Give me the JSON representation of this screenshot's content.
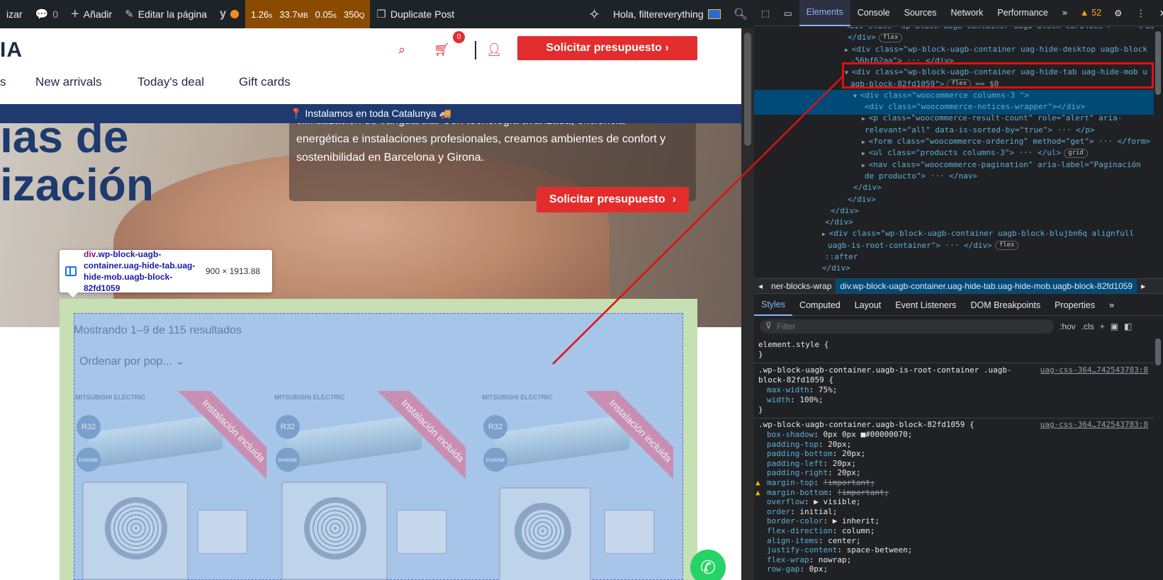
{
  "admin_bar": {
    "customize": "izar",
    "comments_count": "0",
    "add_new": "Añadir",
    "edit_page": "Editar la página",
    "yoast": "y",
    "qm_time": "1.26",
    "qm_time_unit": "s",
    "qm_memory": "33.7",
    "qm_memory_unit": "MB",
    "qm_db_time": "0.05",
    "qm_db_time_unit": "s",
    "qm_queries": "350",
    "qm_queries_unit": "Q",
    "duplicate_post": "Duplicate Post",
    "greeting": "Hola, filtereverything"
  },
  "site": {
    "logo": "IA",
    "cart_count": "0",
    "cta_top": "Solicitar presupuesto ›",
    "nav": [
      "s",
      "New arrivals",
      "Today's deal",
      "Gift cards"
    ],
    "announcement": "📍 Instalamos en toda Catalunya 🚚",
    "hero_line1": "ıas de",
    "hero_line2": "ización",
    "hero_text_1": "climatización de vanguardia. Con tecnología avanzada, eficiencia",
    "hero_text_2": "energética e instalaciones profesionales, creamos ambientes de confort y",
    "hero_text_3": "sostenibilidad en Barcelona y Girona.",
    "hero_cta": "Solicitar presupuesto",
    "hero_cta_arrow": "›",
    "result_count": "Mostrando 1–9 de 115 resultados",
    "ordering": "Ordenar por pop...",
    "products": [
      {
        "brand": "MITSUBISHI ELECTRIC",
        "ribbon": "Instalación incluida",
        "badge1": "R32",
        "badge2": "Inverter"
      },
      {
        "brand": "MITSUBISHI ELECTRIC",
        "ribbon": "Instalación incluida",
        "badge1": "R32",
        "badge2": "Inverter"
      },
      {
        "brand": "MITSUBISHI ELECTRIC",
        "ribbon": "Instalación incluida",
        "badge1": "R32",
        "badge2": "Inverter"
      }
    ]
  },
  "tooltip": {
    "tag": "div",
    "classes": ".wp-block-uagb-container.uag-hide-tab.uag-hide-mob.uagb-block-82fd1059",
    "dims": "900 × 1913.88"
  },
  "devtools": {
    "tabs": [
      "Elements",
      "Console",
      "Sources",
      "Network",
      "Performance"
    ],
    "more": "»",
    "warnings": "52",
    "dom_lines": [
      {
        "t": "<div class=\"wp-block-uagb-container uagb-block-card4dce\"> ··· </div>",
        "indent": 140
      },
      {
        "t": "</div>",
        "indent": 144,
        "pill": "flex"
      },
      {
        "t": "<div class=\"wp-block-uagb-container uag-hide-desktop uagb-block",
        "indent": 140,
        "tri": "▶"
      },
      {
        "t": "-56bf62aa\"> ··· </div>",
        "indent": 148
      },
      {
        "t": "<div class=\"wp-block-uagb-container uag-hide-tab uag-hide-mob u",
        "indent": 140,
        "tri": "▼"
      },
      {
        "t": "agb-block-82fd1059\">",
        "indent": 148,
        "pill": "flex",
        "after": "== $0"
      },
      {
        "t": "<div class=\"woocommerce columns-3 \">",
        "indent": 152,
        "tri": "▼"
      },
      {
        "t": "<div class=\"woocommerce-notices-wrapper\"></div>",
        "indent": 168
      },
      {
        "t": "<p class=\"woocommerce-result-count\" role=\"alert\" aria-",
        "indent": 164,
        "tri": "▶"
      },
      {
        "t": "relevant=\"all\" data-is-sorted-by=\"true\"> ··· </p>",
        "indent": 168
      },
      {
        "t": "<form class=\"woocommerce-ordering\" method=\"get\"> ··· </form>",
        "indent": 164,
        "tri": "▶"
      },
      {
        "t": "<ul class=\"products columns-3\"> ··· </ul>",
        "indent": 164,
        "tri": "▶",
        "pill": "grid"
      },
      {
        "t": "<nav class=\"woocommerce-pagination\" aria-label=\"Paginación",
        "indent": 164,
        "tri": "▶"
      },
      {
        "t": "de producto\"> ··· </nav>",
        "indent": 168
      },
      {
        "t": "</div>",
        "indent": 152
      },
      {
        "t": "</div>",
        "indent": 144
      },
      {
        "t": "</div>",
        "indent": 120
      },
      {
        "t": "</div>",
        "indent": 112
      },
      {
        "t": "<div class=\"wp-block-uagb-container uagb-block-blujbn6q alignfull",
        "indent": 108,
        "tri": "▶"
      },
      {
        "t": "uagb-is-root-container\"> ··· </div>",
        "indent": 116,
        "pill": "flex"
      },
      {
        "t": "::after",
        "indent": 112
      },
      {
        "t": "</div>",
        "indent": 108
      }
    ],
    "crumbs": [
      "◂",
      "ner-blocks-wrap",
      "div.wp-block-uagb-container.uag-hide-tab.uag-hide-mob.uagb-block-82fd1059",
      "▸"
    ],
    "subtabs": [
      "Styles",
      "Computed",
      "Layout",
      "Event Listeners",
      "DOM Breakpoints",
      "Properties",
      "»"
    ],
    "filter_placeholder": "Filter",
    "hov": ":hov",
    "cls": ".cls",
    "rule0": [
      "element.style {",
      "}"
    ],
    "rule1": {
      "selector_1": ".wp-block-uagb-container.uagb-is-root-container .uagb-",
      "selector_2": "block-82fd1059 {",
      "source": "uag-css-364…742543783:8",
      "props": [
        [
          "max-width",
          "75%;"
        ],
        [
          "width",
          "100%;"
        ]
      ]
    },
    "rule2": {
      "selector": ".wp-block-uagb-container.uagb-block-82fd1059 {",
      "source": "uag-css-364…742543783:8",
      "props": [
        [
          "box-shadow",
          "0px 0px ■#00000070;",
          ""
        ],
        [
          "padding-top",
          "20px;",
          ""
        ],
        [
          "padding-bottom",
          "20px;",
          ""
        ],
        [
          "padding-left",
          "20px;",
          ""
        ],
        [
          "padding-right",
          "20px;",
          ""
        ],
        [
          "margin-top",
          "!important;",
          "warn"
        ],
        [
          "margin-bottom",
          "!important;",
          "warn"
        ],
        [
          "overflow",
          "▶ visible;",
          ""
        ],
        [
          "order",
          "initial;",
          ""
        ],
        [
          "border-color",
          "▶ inherit;",
          ""
        ],
        [
          "flex-direction",
          "column;",
          ""
        ],
        [
          "align-items",
          "center;",
          ""
        ],
        [
          "justify-content",
          "space-between;",
          ""
        ],
        [
          "flex-wrap",
          "nowrap;",
          ""
        ],
        [
          "row-gap",
          "0px;",
          ""
        ]
      ]
    }
  }
}
